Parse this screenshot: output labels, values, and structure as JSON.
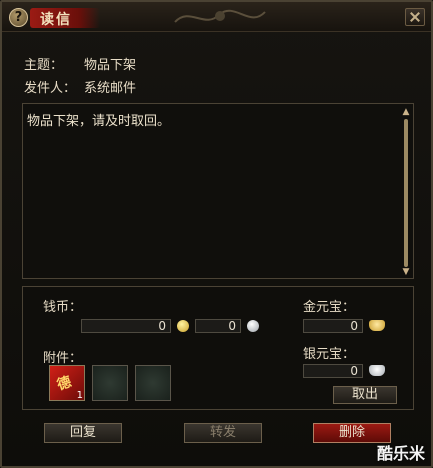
{
  "window": {
    "title": "读信",
    "help_icon": "?",
    "close_icon": "close-icon"
  },
  "mail": {
    "subject_label": "主题：",
    "subject_value": "物品下架",
    "sender_label": "发件人：",
    "sender_value": "系统邮件",
    "body": "物品下架，请及时取回。"
  },
  "attachments": {
    "money_label": "钱币：",
    "gold_coin_value": "0",
    "silver_coin_value": "0",
    "gold_ingot_label": "金元宝：",
    "gold_ingot_value": "0",
    "silver_ingot_label": "银元宝：",
    "silver_ingot_value": "0",
    "items_label": "附件：",
    "item_slot_1": {
      "icon": "red-item-icon",
      "glyph": "德",
      "count": "1"
    },
    "take_button": "取出"
  },
  "buttons": {
    "reply": "回复",
    "forward": "转发",
    "delete": "删除"
  },
  "watermark": "酷乐米"
}
